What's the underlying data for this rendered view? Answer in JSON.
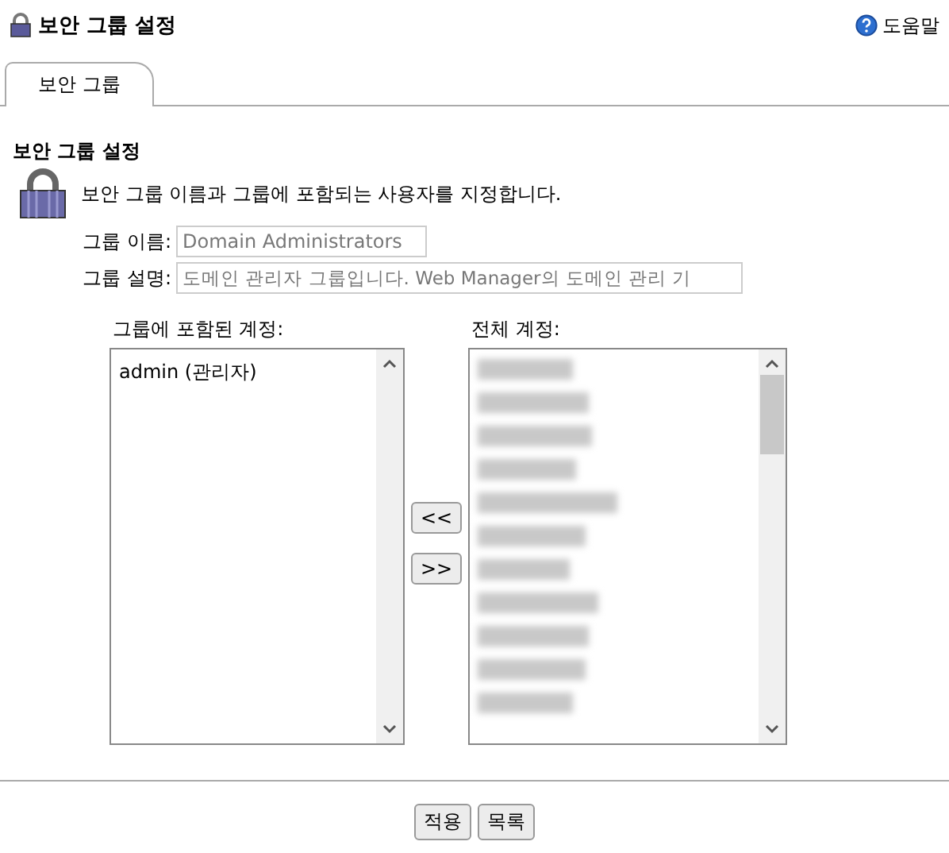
{
  "header": {
    "title": "보안 그룹 설정",
    "help": "도움말"
  },
  "tabs": [
    {
      "label": "보안 그룹",
      "selected": true
    }
  ],
  "section": {
    "title": "보안 그룹 설정",
    "description": "보안 그룹 이름과 그룹에 포함되는 사용자를 지정합니다."
  },
  "fields": [
    {
      "label": "그룹 이름:",
      "value": "Domain Administrators"
    },
    {
      "label": "그룹 설명:",
      "value": "도메인 관리자 그룹입니다. Web Manager의 도메인 관리 기"
    }
  ],
  "member_list": {
    "label": "그룹에 포함된 계정:",
    "items": [
      "admin (관리자)"
    ]
  },
  "move_buttons": [
    "<<",
    ">>"
  ],
  "all_list": {
    "label": "전체 계정:"
  },
  "buttons": [
    "적용",
    "목록"
  ]
}
